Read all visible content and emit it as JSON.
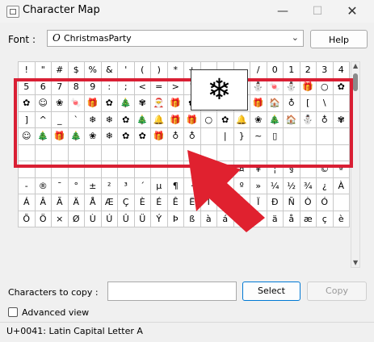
{
  "window": {
    "title": "Character Map",
    "minimize_glyph": "—",
    "maximize_glyph": "☐",
    "close_glyph": "✕"
  },
  "font": {
    "label": "Font :",
    "value": "ChristmasParty",
    "icon_glyph": "O",
    "dropdown_glyph": "⌄"
  },
  "help_label": "Help",
  "grid": {
    "rows": [
      [
        "!",
        "\"",
        "#",
        "$",
        "%",
        "&",
        "'",
        "(",
        ")",
        "*",
        "+",
        ",",
        "-",
        ".",
        "/",
        "0",
        "1",
        "2",
        "3",
        "4"
      ],
      [
        "5",
        "6",
        "7",
        "8",
        "9",
        ":",
        ";",
        "<",
        "=",
        ">",
        "?",
        "❄",
        "🔔",
        "🎄",
        "⛄",
        "🍬",
        "⛄",
        "🎁",
        "○",
        "✿"
      ],
      [
        "✿",
        "☺",
        "❀",
        "🍬",
        "🎁",
        "✿",
        "🎄",
        "✾",
        "🎅",
        "🎁",
        "✿",
        "🔔",
        "⛄",
        "✾",
        "🎁",
        "🏠",
        "♁",
        "[",
        "\\"
      ],
      [
        "]",
        "^",
        "_",
        "`",
        "❄",
        "❄",
        "✿",
        "🎄",
        "🔔",
        "🎁",
        "🎁",
        "○",
        "✿",
        "🔔",
        "❀",
        "🎄",
        "🏠",
        "⛄",
        "♁",
        "✾"
      ],
      [
        "☺",
        "🎄",
        "🎁",
        "🎄",
        "❀",
        "❄",
        "✿",
        "✿",
        "🎁",
        "♁",
        "♁",
        "",
        "|",
        "}",
        "~",
        "▯",
        "",
        "",
        "",
        ""
      ],
      [
        "",
        "",
        "",
        "",
        "",
        "",
        "",
        "",
        "",
        "",
        "",
        "",
        "",
        "",
        "",
        "",
        "",
        "",
        "",
        ""
      ],
      [
        "",
        "",
        "",
        "",
        "",
        "",
        "",
        "",
        "",
        "",
        "¡",
        "¢",
        "£",
        "¤",
        "¥",
        "¦",
        "§",
        "¨",
        "©",
        "ª",
        "«"
      ],
      [
        "-",
        "®",
        "¯",
        "°",
        "±",
        "²",
        "³",
        "´",
        "µ",
        "¶",
        "·",
        "¸",
        "¹",
        "º",
        "»",
        "¼",
        "½",
        "¾",
        "¿",
        "À"
      ],
      [
        "Á",
        "Â",
        "Ã",
        "Ä",
        "Å",
        "Æ",
        "Ç",
        "È",
        "É",
        "Ê",
        "Ë",
        "Ì",
        "Í",
        "Î",
        "Ï",
        "Ð",
        "Ñ",
        "Ò",
        "Ó"
      ],
      [
        "Õ",
        "Ö",
        "×",
        "Ø",
        "Ù",
        "Ú",
        "Û",
        "Ü",
        "Ý",
        "Þ",
        "ß",
        "à",
        "á",
        "â",
        "ã",
        "ä",
        "å",
        "æ",
        "ç",
        "è"
      ]
    ]
  },
  "zoom_glyph": "❄",
  "scroll": {
    "up_glyph": "▲",
    "down_glyph": "▼"
  },
  "copy": {
    "label": "Characters to copy :",
    "value": "",
    "select_label": "Select",
    "copy_label": "Copy"
  },
  "advanced": {
    "label": "Advanced view",
    "checked": false
  },
  "status": "U+0041: Latin Capital Letter A",
  "colors": {
    "highlight": "#d91f34",
    "arrow": "#e0212f"
  }
}
